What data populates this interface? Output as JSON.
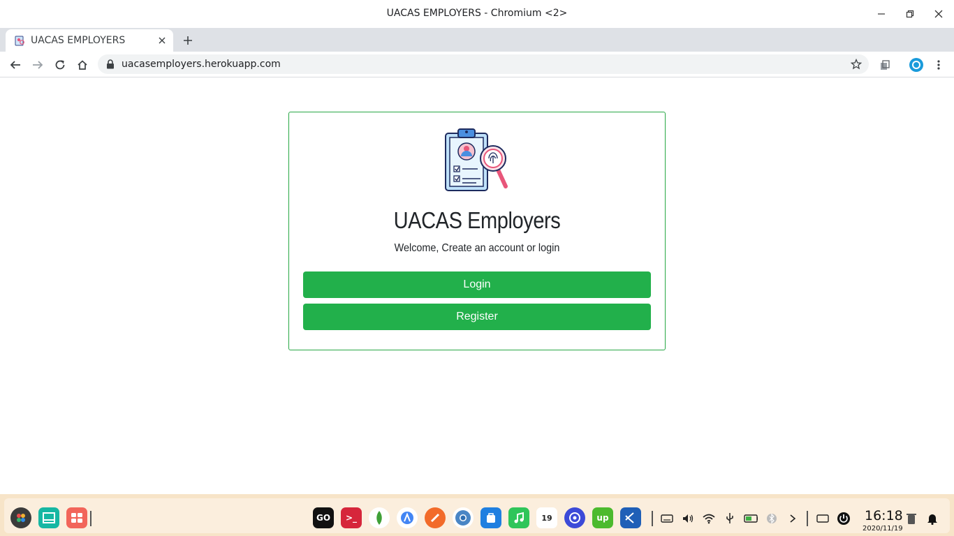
{
  "window": {
    "title": "UACAS EMPLOYERS - Chromium <2>"
  },
  "tab": {
    "title": "UACAS EMPLOYERS"
  },
  "omnibox": {
    "url": "uacasemployers.herokuapp.com"
  },
  "page": {
    "heading": "UACAS Employers",
    "subtitle": "Welcome, Create an account or login",
    "login_label": "Login",
    "register_label": "Register",
    "accent_color": "#22b04b"
  },
  "taskbar": {
    "time": "16:18",
    "date": "2020/11/19",
    "calendar_day": "19",
    "apps": [
      "launcher-icon",
      "files-icon",
      "app-store-icon",
      "goland-icon",
      "terminal-icon",
      "mongodb-icon",
      "android-studio-icon",
      "postman-icon",
      "chromium-icon",
      "deepin-store-icon",
      "music-icon",
      "calendar-icon",
      "settings-icon",
      "upwork-icon",
      "vscode-icon"
    ]
  }
}
